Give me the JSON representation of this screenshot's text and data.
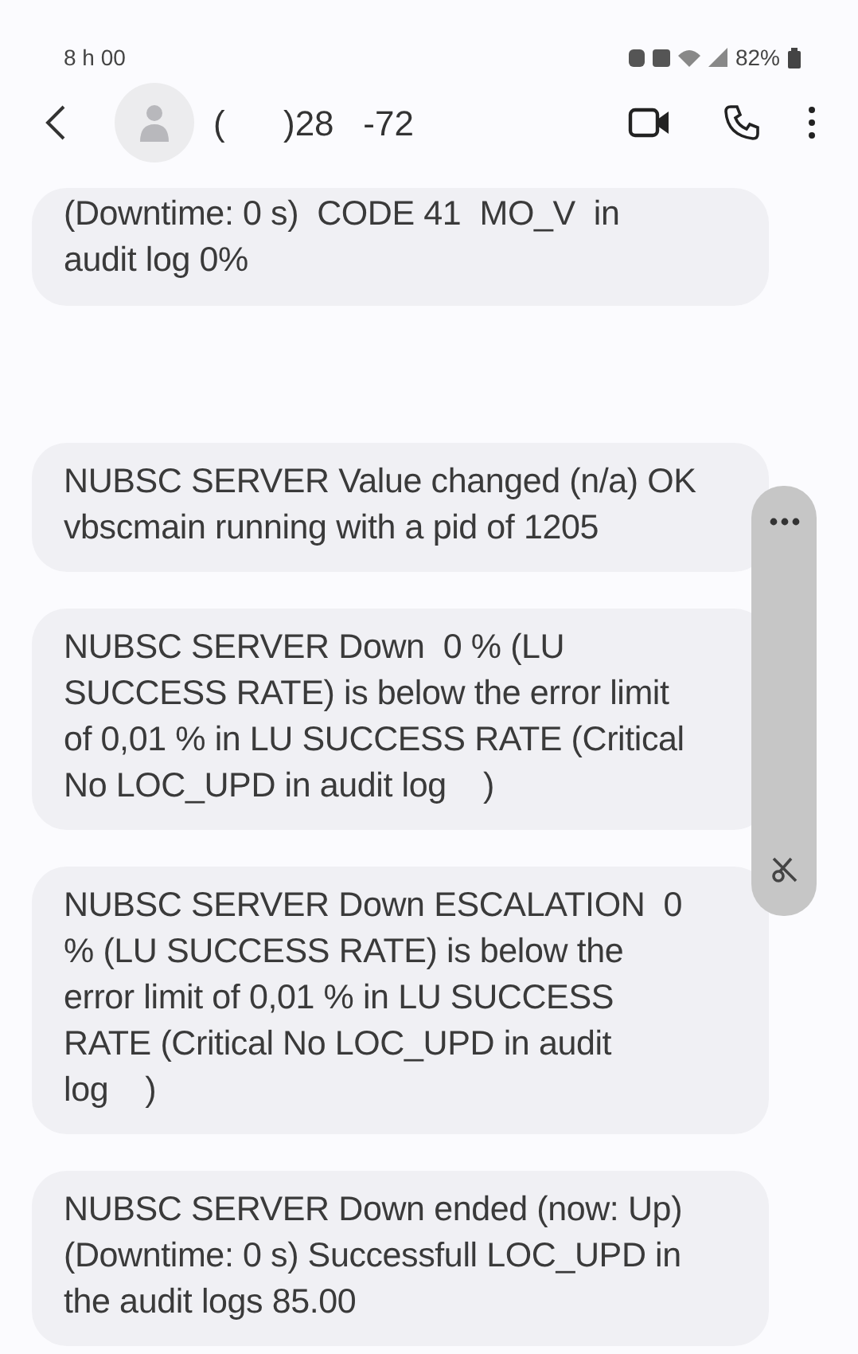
{
  "status_bar": {
    "time": "8 h 00",
    "battery": "82%"
  },
  "header": {
    "contact": "(      )28   -72"
  },
  "messages": [
    {
      "lines": [
        "(Downtime: 0 s)  CODE 41  MO_V  in",
        "audit log 0%"
      ]
    },
    {
      "lines": [
        "NUBSC SERVER Value changed (n/a) OK",
        "vbscmain running with a pid of 1205"
      ]
    },
    {
      "lines": [
        "NUBSC SERVER Down  0 % (LU",
        "SUCCESS RATE) is below the error limit",
        "of 0,01 % in LU SUCCESS RATE (Critical",
        "No LOC_UPD in audit log    )"
      ]
    },
    {
      "lines": [
        "NUBSC SERVER Down ESCALATION  0",
        "% (LU SUCCESS RATE) is below the",
        "error limit of 0,01 % in LU SUCCESS",
        "RATE (Critical No LOC_UPD in audit",
        "log    )"
      ]
    },
    {
      "lines": [
        "NUBSC SERVER Down ended (now: Up)",
        "(Downtime: 0 s) Successfull LOC_UPD in",
        "the audit logs 85.00"
      ]
    }
  ]
}
